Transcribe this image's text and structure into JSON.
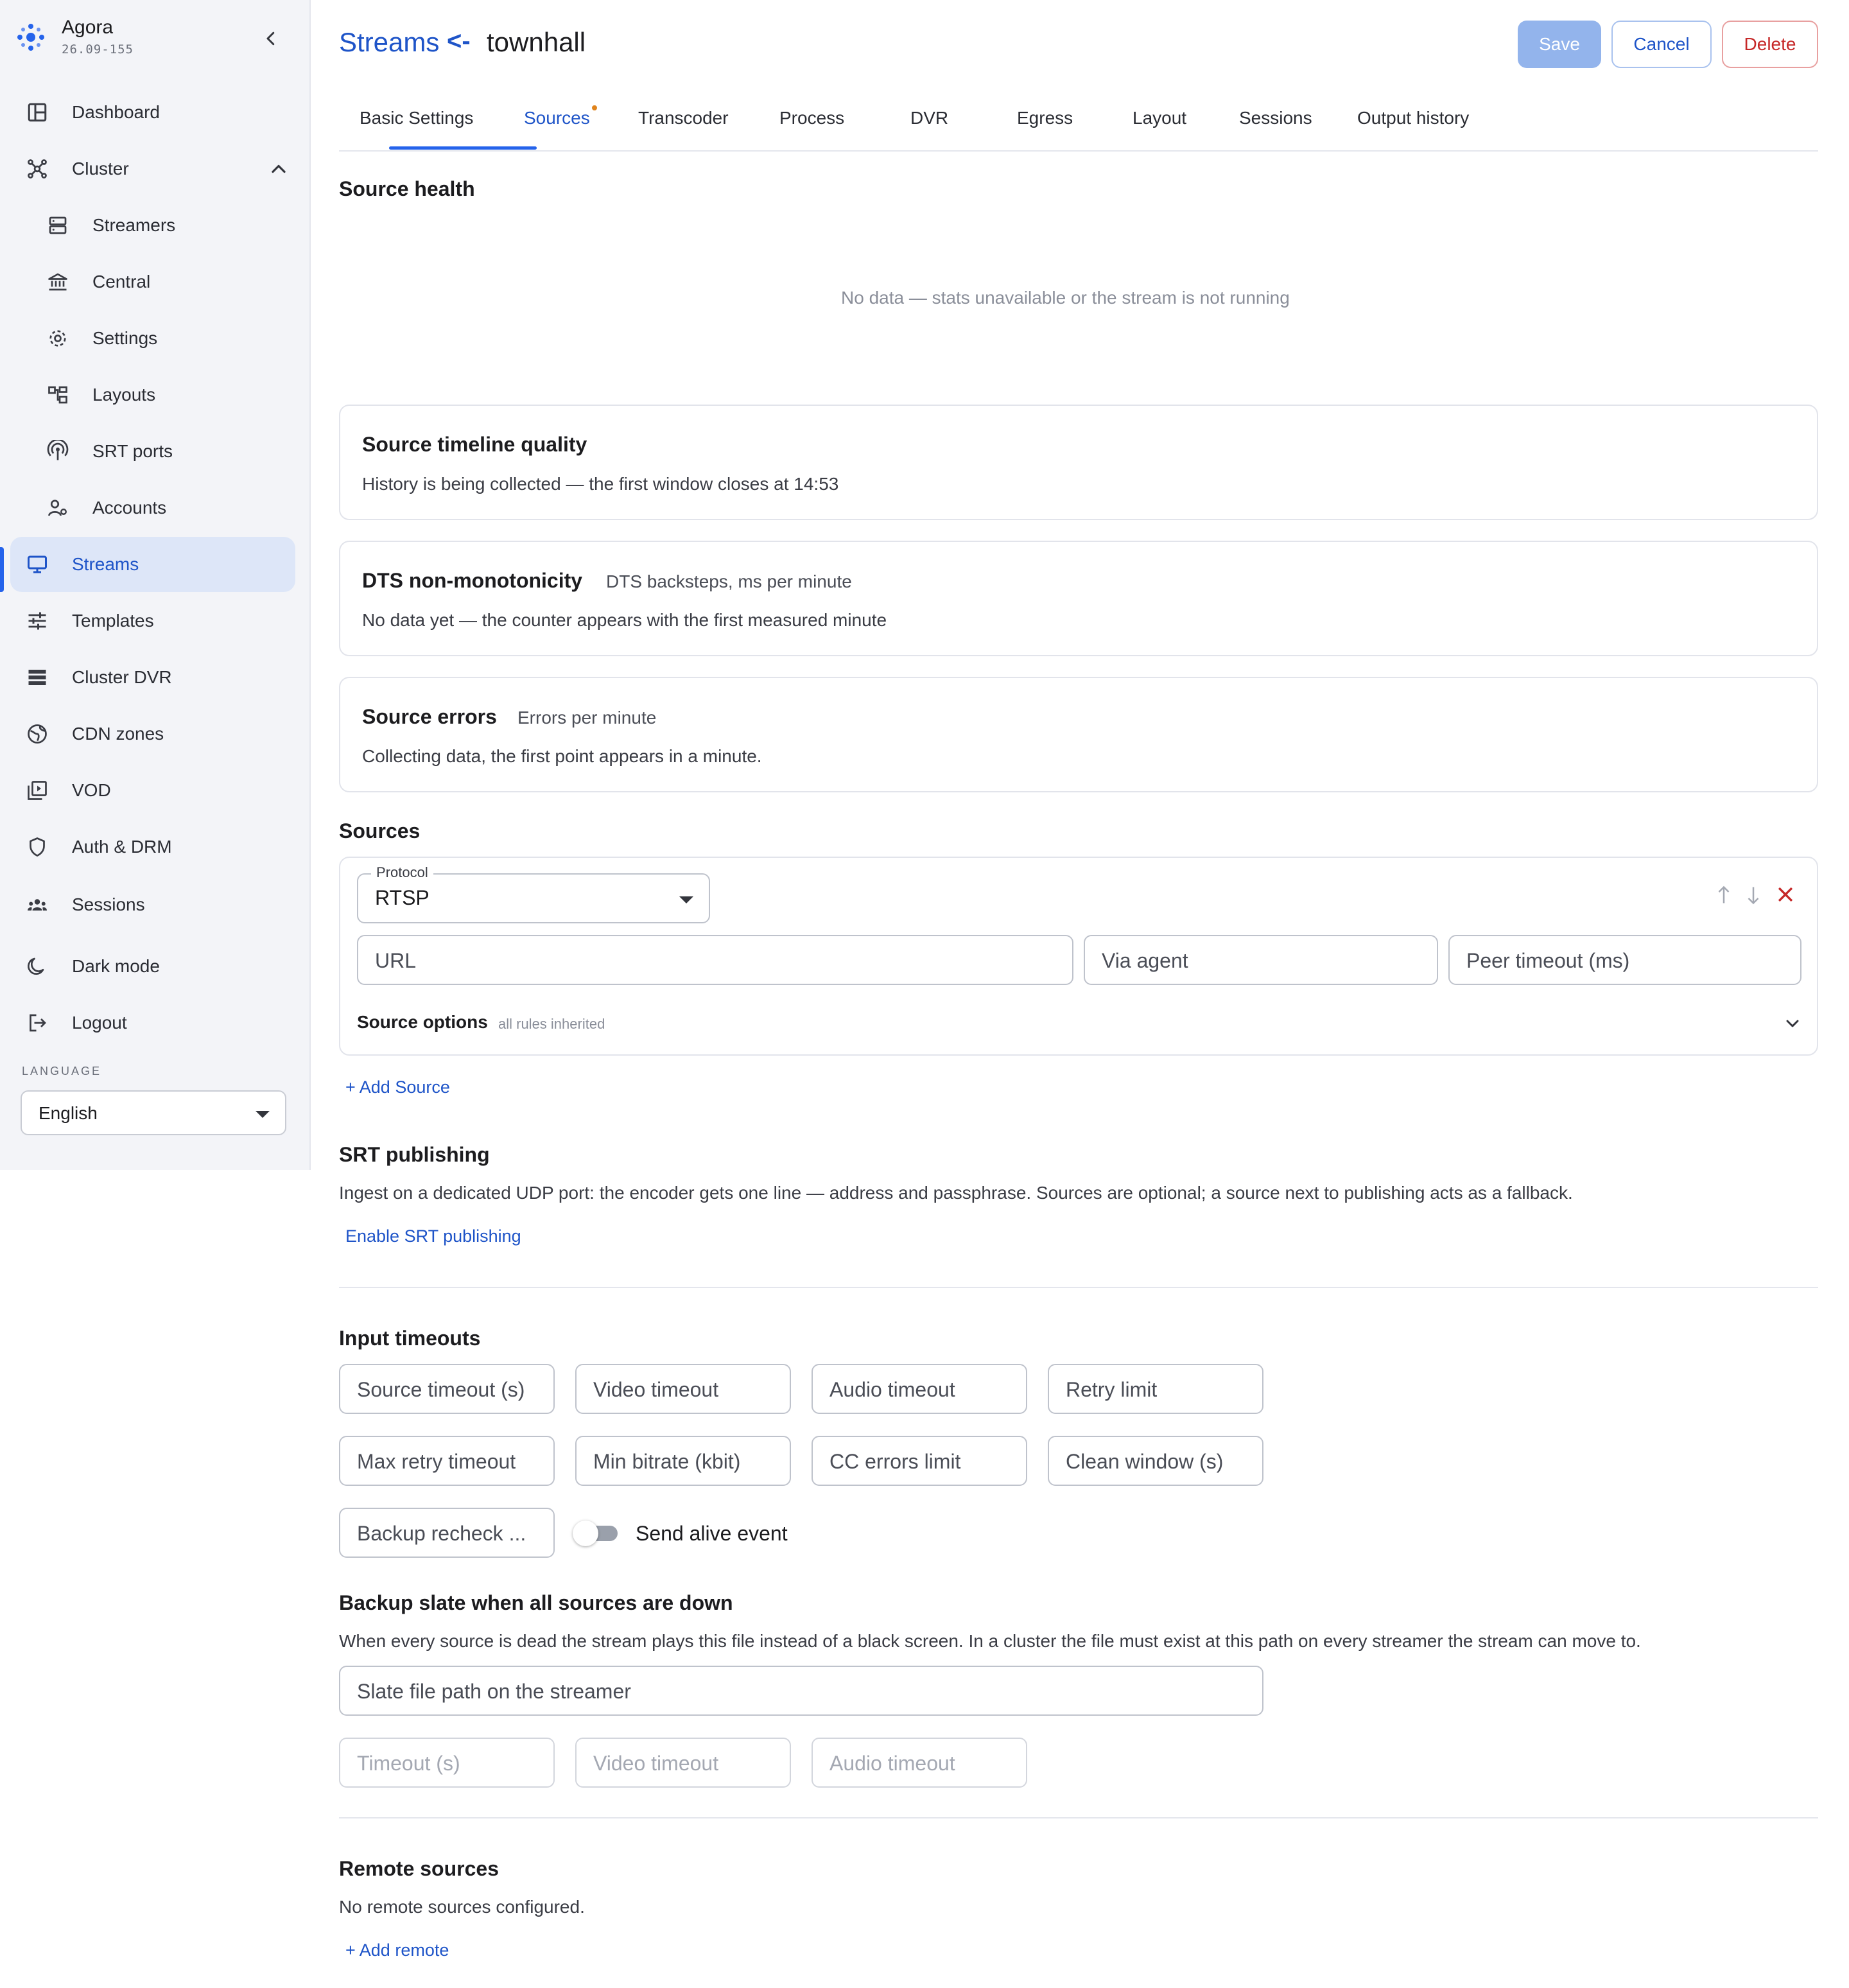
{
  "app": {
    "name": "Agora",
    "version": "26.09-155"
  },
  "sidebar": {
    "items": [
      {
        "label": "Dashboard",
        "icon": "dashboard-icon"
      },
      {
        "label": "Cluster",
        "icon": "cluster-icon",
        "expanded": true
      },
      {
        "label": "Streamers",
        "icon": "server-icon"
      },
      {
        "label": "Central",
        "icon": "bank-icon"
      },
      {
        "label": "Settings",
        "icon": "gear-icon"
      },
      {
        "label": "Layouts",
        "icon": "layouts-icon"
      },
      {
        "label": "SRT ports",
        "icon": "antenna-icon"
      },
      {
        "label": "Accounts",
        "icon": "accounts-icon"
      },
      {
        "label": "Streams",
        "icon": "monitor-icon",
        "active": true
      },
      {
        "label": "Templates",
        "icon": "sliders-icon"
      },
      {
        "label": "Cluster DVR",
        "icon": "storage-icon"
      },
      {
        "label": "CDN zones",
        "icon": "globe-icon"
      },
      {
        "label": "VOD",
        "icon": "video-library-icon"
      },
      {
        "label": "Auth & DRM",
        "icon": "shield-icon"
      },
      {
        "label": "Sessions",
        "icon": "people-icon"
      },
      {
        "label": "Dark mode",
        "icon": "moon-icon"
      },
      {
        "label": "Logout",
        "icon": "logout-icon"
      }
    ],
    "language_label": "LANGUAGE",
    "language_value": "English"
  },
  "header": {
    "crumb": "Streams",
    "crumb_sep": "<-",
    "title": "townhall",
    "save_label": "Save",
    "cancel_label": "Cancel",
    "delete_label": "Delete"
  },
  "tabs": [
    {
      "label": "Basic Settings"
    },
    {
      "label": "Sources",
      "active": true,
      "has_changes": true
    },
    {
      "label": "Transcoder"
    },
    {
      "label": "Process"
    },
    {
      "label": "DVR"
    },
    {
      "label": "Egress"
    },
    {
      "label": "Layout"
    },
    {
      "label": "Sessions"
    },
    {
      "label": "Output history"
    }
  ],
  "source_health": {
    "title": "Source health",
    "empty": "No data — stats unavailable or the stream is not running"
  },
  "cards": {
    "timeline": {
      "title": "Source timeline quality",
      "text": "History is being collected — the first window closes at 14:53"
    },
    "dts": {
      "title": "DTS non-monotonicity",
      "subtitle": "DTS backsteps, ms per minute",
      "text": "No data yet — the counter appears with the first measured minute"
    },
    "errors": {
      "title": "Source errors",
      "subtitle": "Errors per minute",
      "text": "Collecting data, the first point appears in a minute."
    }
  },
  "sources": {
    "title": "Sources",
    "protocol_label": "Protocol",
    "protocol_value": "RTSP",
    "url_placeholder": "URL",
    "via_agent_placeholder": "Via agent",
    "peer_timeout_placeholder": "Peer timeout (ms)",
    "options_label": "Source options",
    "options_hint": "all rules inherited",
    "add_label": "+ Add Source"
  },
  "srt": {
    "title": "SRT publishing",
    "text": "Ingest on a dedicated UDP port: the encoder gets one line — address and passphrase. Sources are optional; a source next to publishing acts as a fallback.",
    "enable_label": "Enable SRT publishing"
  },
  "input_timeouts": {
    "title": "Input timeouts",
    "fields": [
      "Source timeout (s)",
      "Video timeout",
      "Audio timeout",
      "Retry limit",
      "Max retry timeout",
      "Min bitrate (kbit)",
      "CC errors limit",
      "Clean window (s)",
      "Backup recheck ..."
    ],
    "alive_label": "Send alive event",
    "alive_on": false
  },
  "backup_slate": {
    "title": "Backup slate when all sources are down",
    "text": "When every source is dead the stream plays this file instead of a black screen. In a cluster the file must exist at this path on every streamer the stream can move to.",
    "path_placeholder": "Slate file path on the streamer",
    "timeout_placeholder": "Timeout (s)",
    "video_placeholder": "Video timeout",
    "audio_placeholder": "Audio timeout"
  },
  "remote_sources": {
    "title": "Remote sources",
    "empty": "No remote sources configured.",
    "add_label": "+ Add remote"
  },
  "colors": {
    "accent": "#1e54c8",
    "danger": "#c62828",
    "active_bg": "#dde6f8",
    "tab_dot": "#e0841c"
  }
}
